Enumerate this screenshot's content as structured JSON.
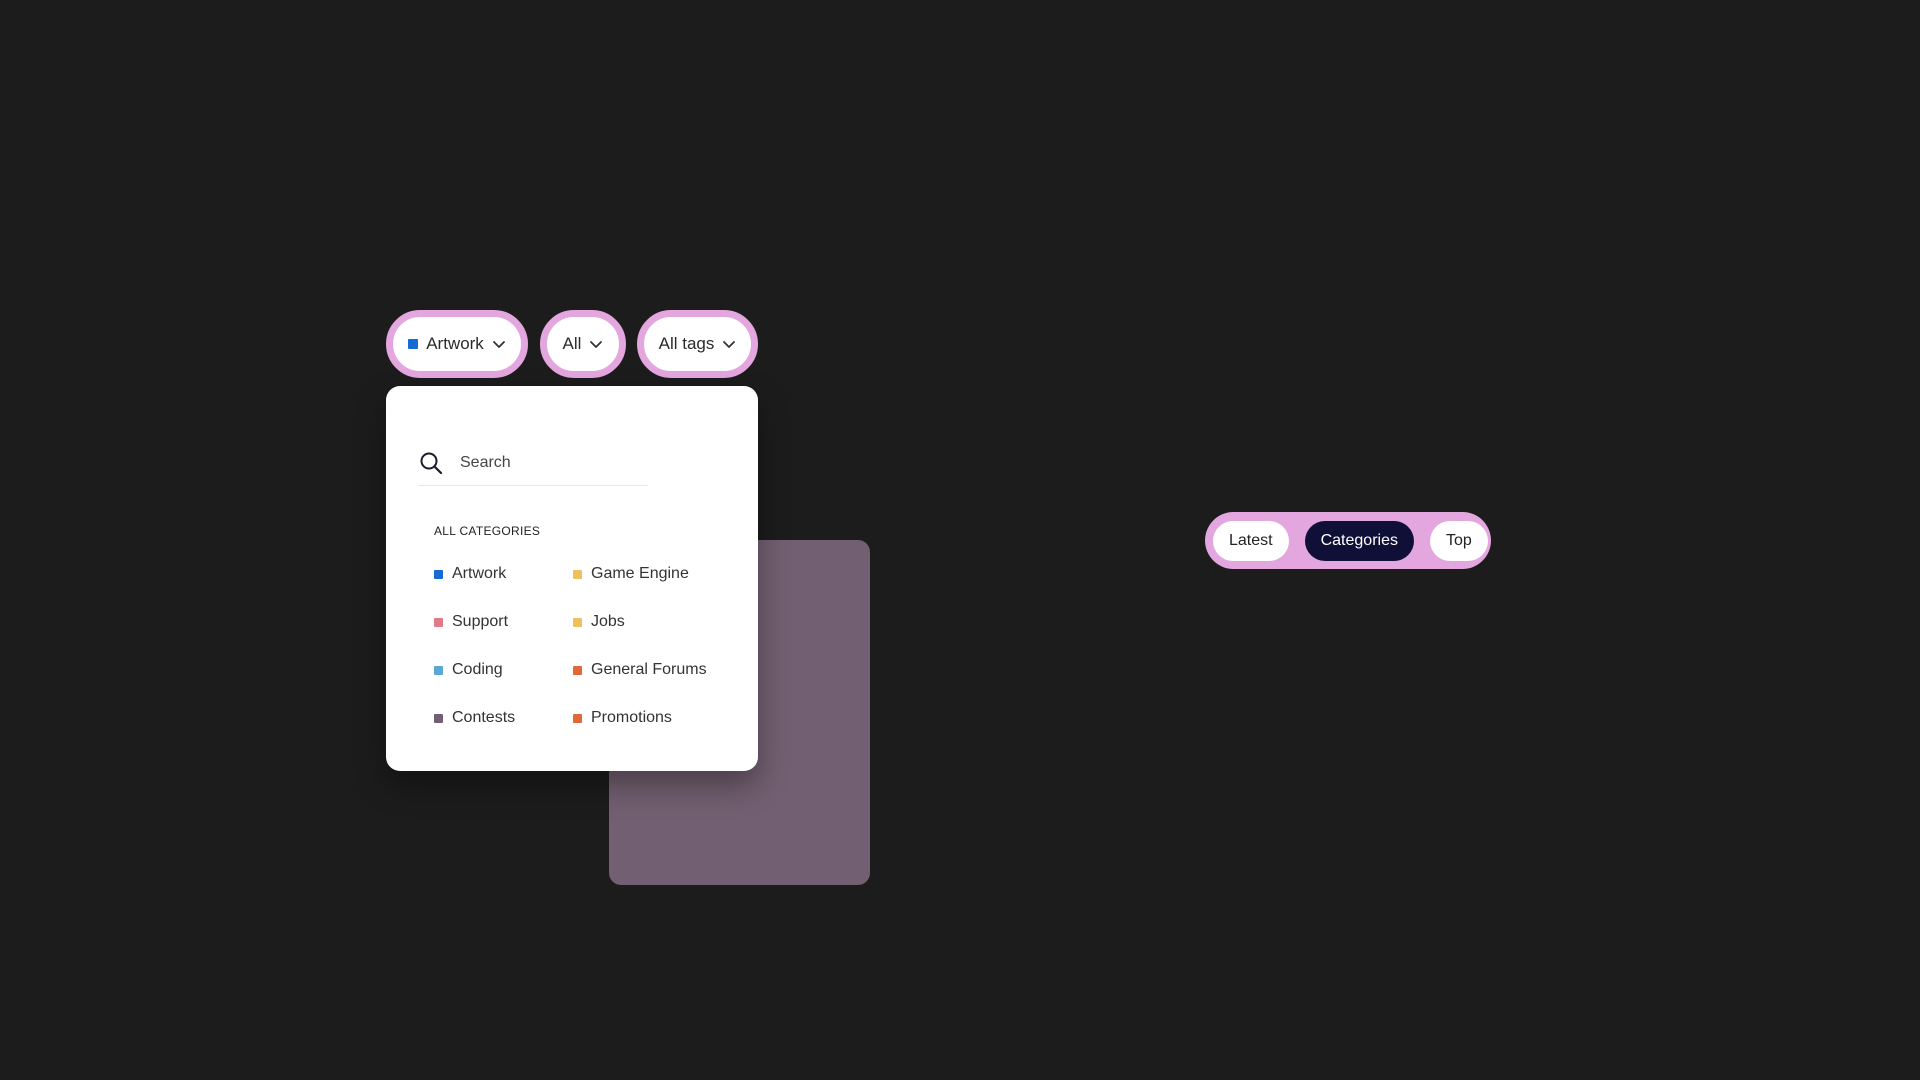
{
  "filters": {
    "category": {
      "label": "Artwork",
      "color": "#1769d4"
    },
    "status": {
      "label": "All"
    },
    "tags": {
      "label": "All tags"
    }
  },
  "dropdown": {
    "search": {
      "placeholder": "Search",
      "value": ""
    },
    "heading": "ALL CATEGORIES",
    "categories": [
      {
        "label": "Artwork",
        "color": "#1769d4"
      },
      {
        "label": "Game Engine",
        "color": "#f0c060"
      },
      {
        "label": "Support",
        "color": "#e07a85"
      },
      {
        "label": "Jobs",
        "color": "#f0c060"
      },
      {
        "label": "Coding",
        "color": "#5aa7d8"
      },
      {
        "label": "General Forums",
        "color": "#e0683a"
      },
      {
        "label": "Contests",
        "color": "#725f71"
      },
      {
        "label": "Promotions",
        "color": "#e0683a"
      }
    ]
  },
  "nav": {
    "tabs": [
      {
        "label": "Latest",
        "active": false
      },
      {
        "label": "Categories",
        "active": true
      },
      {
        "label": "Top",
        "active": false
      }
    ]
  },
  "colors": {
    "background": "#1c1c1c",
    "accent_pink": "#e4a6df",
    "active_navy": "#100f38",
    "mauve_card": "#725f71"
  },
  "icons": {
    "search": "search-icon",
    "chevron": "chevron-down-icon"
  }
}
